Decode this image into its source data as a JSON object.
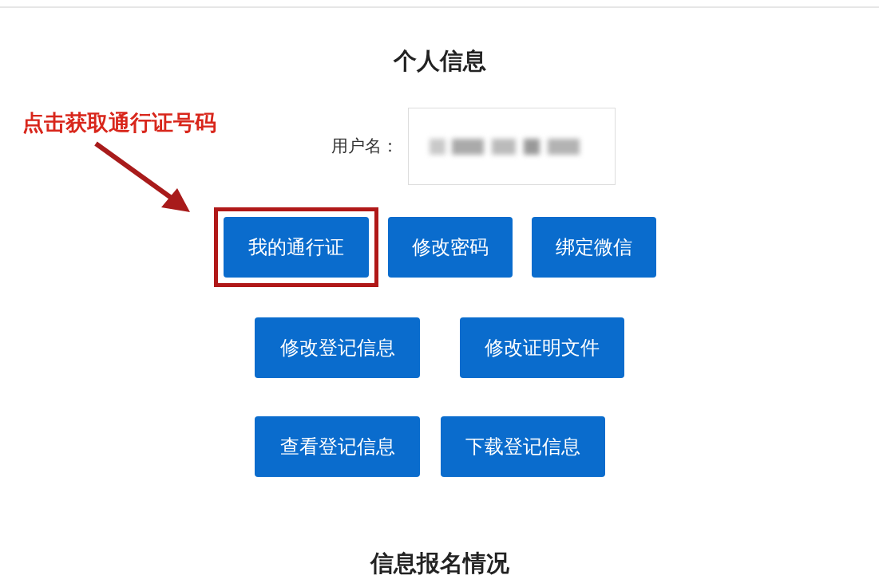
{
  "title": "个人信息",
  "annotation": {
    "text": "点击获取通行证号码"
  },
  "username": {
    "label": "用户名："
  },
  "button_rows": [
    [
      {
        "label": "我的通行证",
        "highlighted": true
      },
      {
        "label": "修改密码",
        "highlighted": false
      },
      {
        "label": "绑定微信",
        "highlighted": false
      }
    ],
    [
      {
        "label": "修改登记信息",
        "highlighted": false
      },
      {
        "label": "修改证明文件",
        "highlighted": false
      }
    ],
    [
      {
        "label": "查看登记信息",
        "highlighted": false
      },
      {
        "label": "下载登记信息",
        "highlighted": false
      }
    ]
  ],
  "section_heading": "信息报名情况"
}
